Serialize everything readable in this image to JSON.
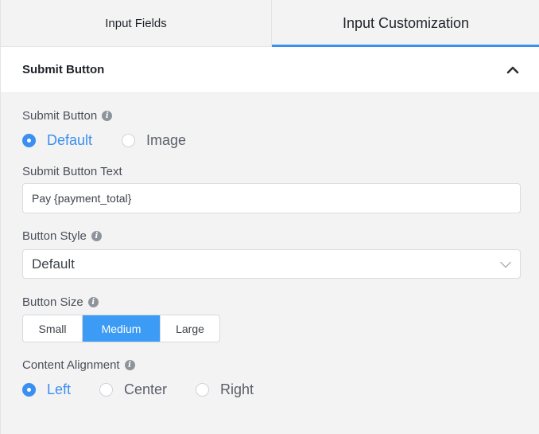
{
  "tabs": {
    "input_fields": "Input Fields",
    "input_customization": "Input Customization"
  },
  "section": {
    "title": "Submit Button"
  },
  "submit_button": {
    "label": "Submit Button",
    "options": [
      "Default",
      "Image"
    ],
    "selected": "Default"
  },
  "submit_text": {
    "label": "Submit Button Text",
    "value": "Pay {payment_total}"
  },
  "button_style": {
    "label": "Button Style",
    "value": "Default"
  },
  "button_size": {
    "label": "Button Size",
    "options": [
      "Small",
      "Medium",
      "Large"
    ],
    "selected": "Medium"
  },
  "content_alignment": {
    "label": "Content Alignment",
    "options": [
      "Left",
      "Center",
      "Right"
    ],
    "selected": "Left"
  },
  "icons": {
    "info": "info-icon",
    "collapse": "chevron-up-icon",
    "dropdown": "chevron-down-icon"
  },
  "colors": {
    "accent": "#3b8ff0",
    "segment_active": "#3b9bf5"
  }
}
